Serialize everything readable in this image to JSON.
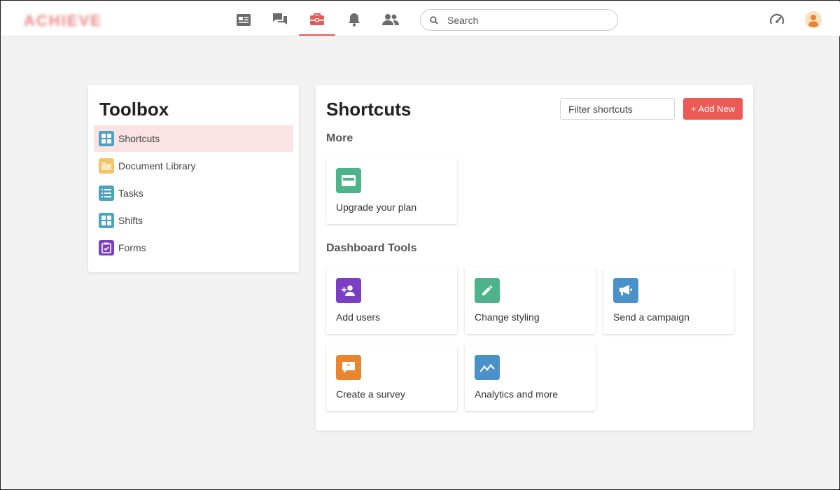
{
  "topbar": {
    "logo_text": "ACHIEVE",
    "nav_icons": [
      "newsfeed-icon",
      "chat-icon",
      "toolbox-icon",
      "bell-icon",
      "people-icon"
    ],
    "active_nav": "toolbox-icon",
    "search_placeholder": "Search",
    "right_icons": [
      "speedometer-icon",
      "user-avatar-icon"
    ]
  },
  "toolbox": {
    "title": "Toolbox",
    "items": [
      {
        "label": "Shortcuts",
        "icon": "grid-icon",
        "color": "#4aa3c4",
        "active": true
      },
      {
        "label": "Document Library",
        "icon": "folder-icon",
        "color": "#f2c46b",
        "active": false
      },
      {
        "label": "Tasks",
        "icon": "list-icon",
        "color": "#4aa3c4",
        "active": false
      },
      {
        "label": "Shifts",
        "icon": "grid-icon",
        "color": "#4aa3c4",
        "active": false
      },
      {
        "label": "Forms",
        "icon": "clipboard-check-icon",
        "color": "#7b3fc4",
        "active": false
      }
    ]
  },
  "shortcuts": {
    "title": "Shortcuts",
    "filter_placeholder": "Filter shortcuts",
    "add_label": "+ Add New",
    "sections": [
      {
        "title": "More",
        "tiles": [
          {
            "label": "Upgrade your plan",
            "icon": "credit-card-icon",
            "color": "#4cb38a"
          }
        ]
      },
      {
        "title": "Dashboard Tools",
        "tiles": [
          {
            "label": "Add users",
            "icon": "add-user-icon",
            "color": "#7b3fc4"
          },
          {
            "label": "Change styling",
            "icon": "pencil-icon",
            "color": "#4cb38a"
          },
          {
            "label": "Send a campaign",
            "icon": "megaphone-icon",
            "color": "#4a90c9"
          },
          {
            "label": "Create a survey",
            "icon": "quote-bubble-icon",
            "color": "#e8852e"
          },
          {
            "label": "Analytics and more",
            "icon": "trend-line-icon",
            "color": "#4a90c9"
          }
        ]
      }
    ]
  },
  "colors": {
    "accent": "#ec5a56",
    "active_bg": "#fbe3e3",
    "page_bg": "#f2f2f2"
  }
}
